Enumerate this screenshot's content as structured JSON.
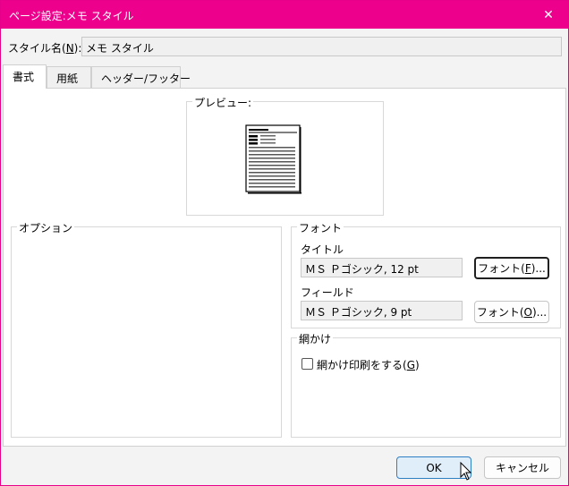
{
  "window": {
    "title": "ページ設定:メモ スタイル",
    "close_glyph": "✕"
  },
  "style_name": {
    "label_prefix": "スタイル名(",
    "label_key": "N",
    "label_suffix": "):",
    "value": "メモ スタイル"
  },
  "tabs": [
    {
      "label": "書式",
      "active": true
    },
    {
      "label": "用紙",
      "active": false
    },
    {
      "label": "ヘッダー/フッター",
      "active": false
    }
  ],
  "preview": {
    "caption": "プレビュー:"
  },
  "options": {
    "caption": "オプション"
  },
  "font_group": {
    "caption": "フォント",
    "title_label": "タイトル",
    "title_value": "ＭＳ Ｐゴシック, 12 pt",
    "title_button_prefix": "フォント(",
    "title_button_key": "F",
    "title_button_suffix": ")...",
    "field_label": "フィールド",
    "field_value": "ＭＳ Ｐゴシック, 9 pt",
    "field_button_prefix": "フォント(",
    "field_button_key": "O",
    "field_button_suffix": ")..."
  },
  "shading_group": {
    "caption": "網かけ",
    "checkbox_prefix": "網かけ印刷をする(",
    "checkbox_key": "G",
    "checkbox_suffix": ")",
    "checked": false
  },
  "footer": {
    "ok_label": "OK",
    "cancel_label": "キャンセル"
  }
}
